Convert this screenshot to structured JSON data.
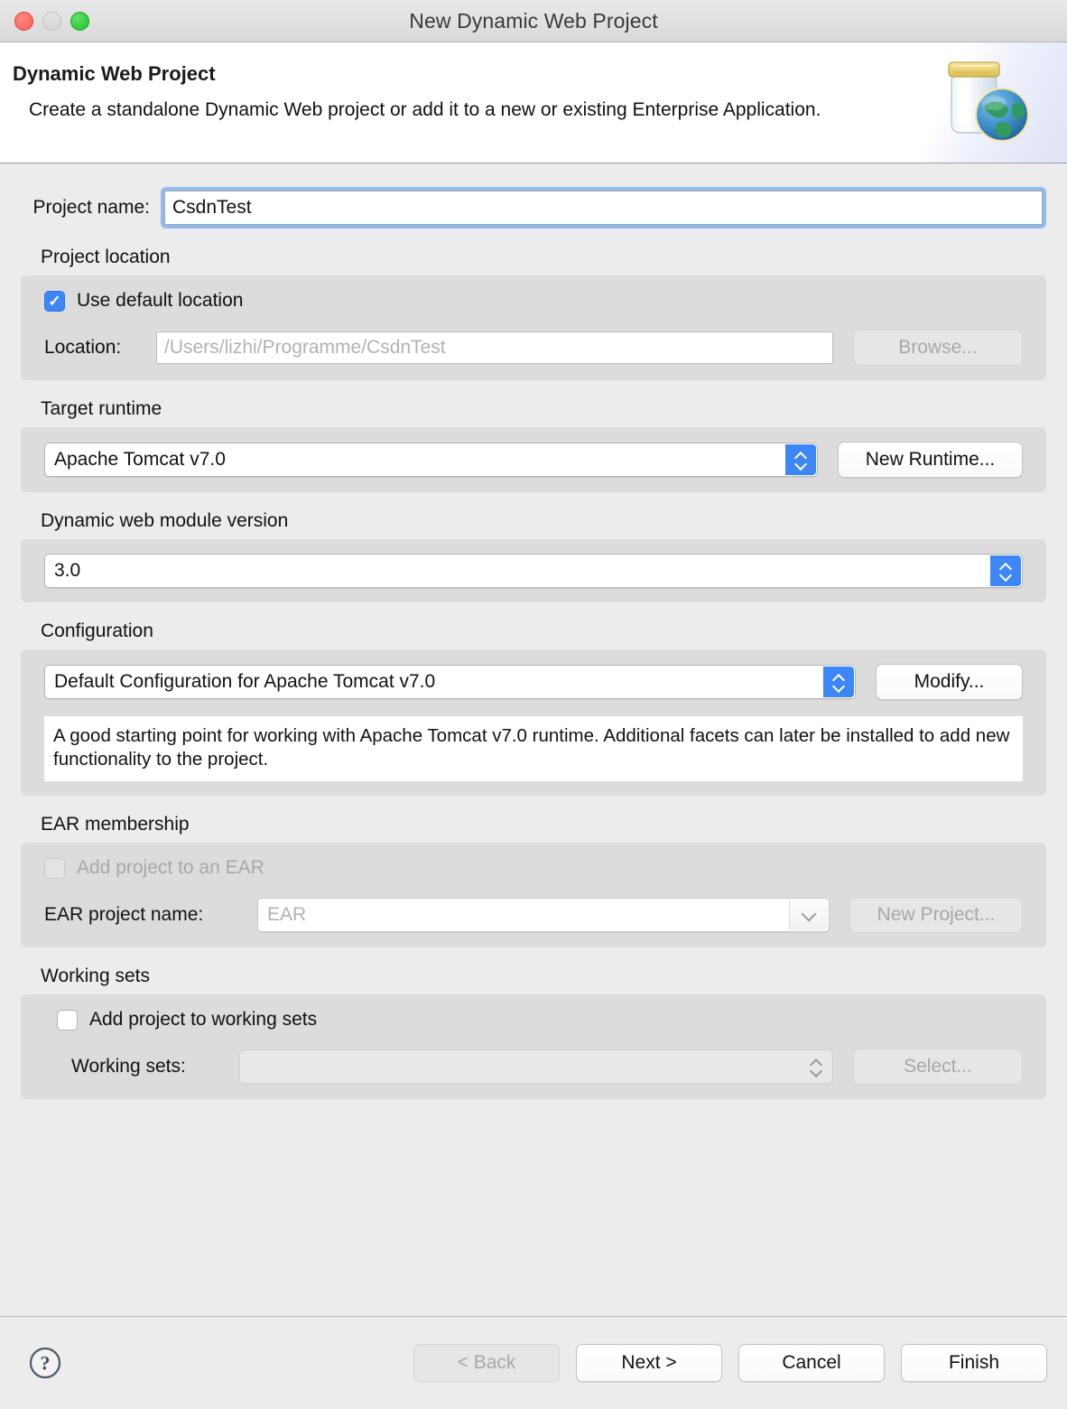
{
  "window": {
    "title": "New Dynamic Web Project",
    "controls": {
      "close": "close-button",
      "minimize": "minimize-button",
      "maximize": "maximize-button"
    }
  },
  "header": {
    "title": "Dynamic Web Project",
    "subtitle": "Create a standalone Dynamic Web project or add it to a new or existing Enterprise Application.",
    "icon": "war-jar-globe-icon"
  },
  "project_name": {
    "label": "Project name:",
    "value": "CsdnTest",
    "placeholder": ""
  },
  "project_location": {
    "section_label": "Project location",
    "use_default_label": "Use default location",
    "use_default_checked": true,
    "location_label": "Location:",
    "location_value": "/Users/lizhi/Programme/CsdnTest",
    "browse_label": "Browse...",
    "browse_disabled": true
  },
  "target_runtime": {
    "section_label": "Target runtime",
    "selected": "Apache Tomcat v7.0",
    "new_runtime_label": "New Runtime..."
  },
  "module_version": {
    "section_label": "Dynamic web module version",
    "selected": "3.0"
  },
  "configuration": {
    "section_label": "Configuration",
    "selected": "Default Configuration for Apache Tomcat v7.0",
    "modify_label": "Modify...",
    "description": "A good starting point for working with Apache Tomcat v7.0 runtime. Additional facets can later be installed to add new functionality to the project."
  },
  "ear_membership": {
    "section_label": "EAR membership",
    "add_to_ear_label": "Add project to an EAR",
    "add_to_ear_checked": false,
    "add_to_ear_disabled": true,
    "ear_project_label": "EAR project name:",
    "ear_project_value": "EAR",
    "new_project_label": "New Project...",
    "new_project_disabled": true
  },
  "working_sets": {
    "section_label": "Working sets",
    "add_to_working_sets_label": "Add project to working sets",
    "add_to_working_sets_checked": false,
    "working_sets_label": "Working sets:",
    "working_sets_value": "",
    "select_label": "Select...",
    "select_disabled": true
  },
  "footer": {
    "help": "help-icon",
    "back_label": "< Back",
    "back_disabled": true,
    "next_label": "Next >",
    "cancel_label": "Cancel",
    "finish_label": "Finish"
  },
  "colors": {
    "accent_blue": "#3d86f5",
    "focus_ring": "#8fbcec",
    "dialog_bg": "#ececec",
    "group_bg": "#dcdcdc",
    "close": "#fa5e55",
    "maximize": "#1fbf33"
  }
}
